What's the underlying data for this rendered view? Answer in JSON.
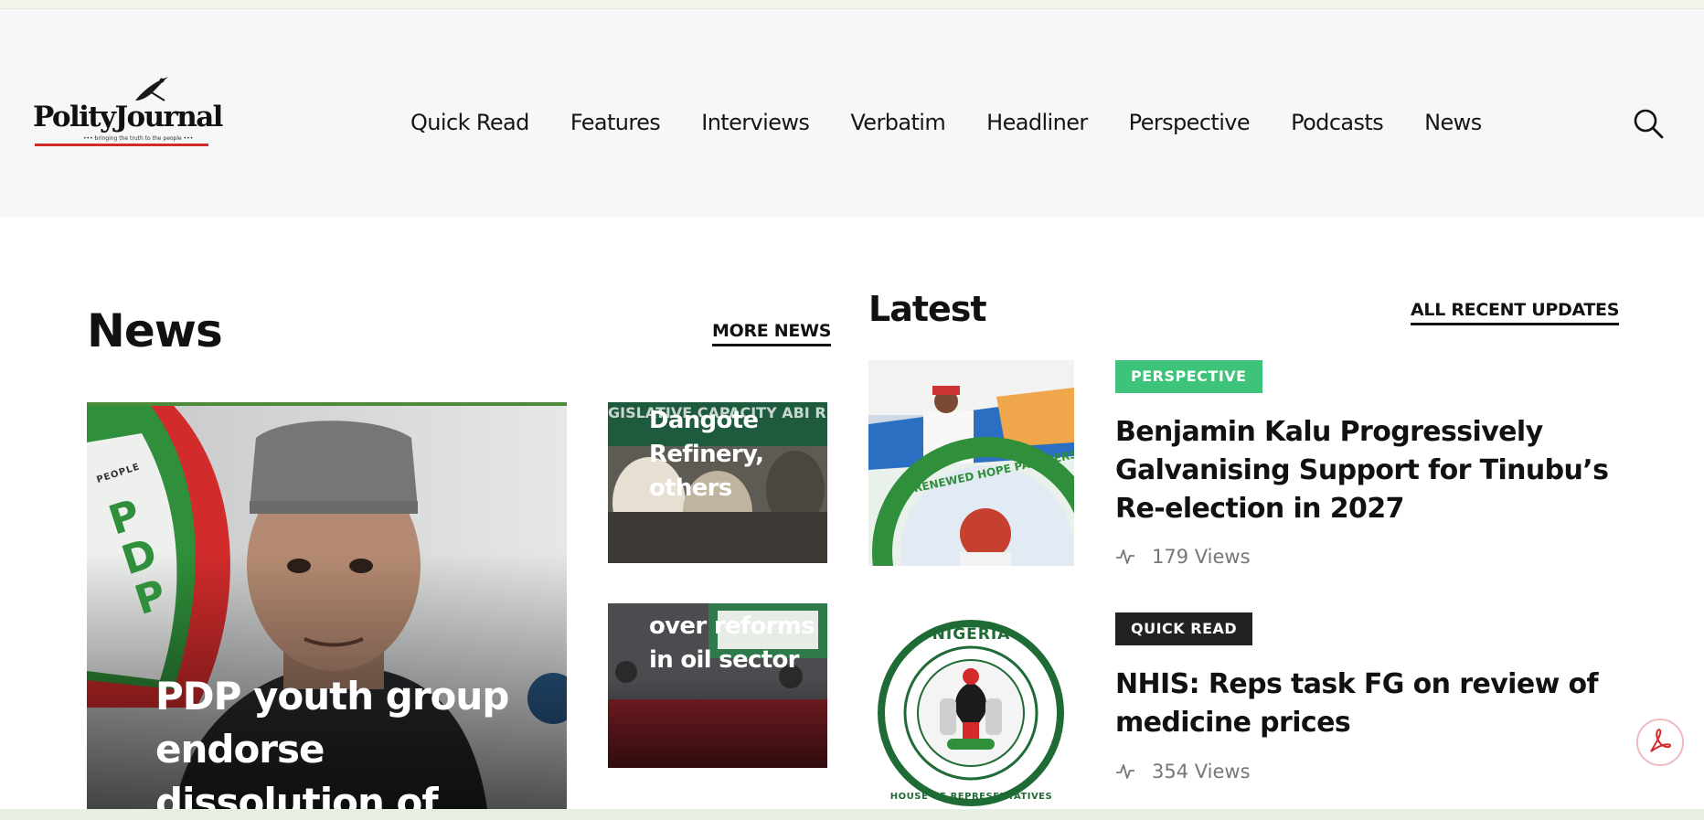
{
  "brand": {
    "logo_text": "PolityJournal",
    "tagline": "••• bringing the truth to the people •••",
    "accent_color": "#d42a2a"
  },
  "nav": {
    "items": [
      "Quick Read",
      "Features",
      "Interviews",
      "Verbatim",
      "Headliner",
      "Perspective",
      "Podcasts",
      "News"
    ],
    "search_icon": "search-icon"
  },
  "news_section": {
    "title": "News",
    "more_label": "MORE NEWS",
    "hero_title": "PDP youth group endorse dissolution of",
    "cards": [
      {
        "title": "Dangote Refinery, others"
      },
      {
        "title": "over reforms in oil sector"
      }
    ]
  },
  "latest_section": {
    "title": "Latest",
    "all_label": "ALL RECENT UPDATES",
    "items": [
      {
        "category": "PERSPECTIVE",
        "category_color": "#3ec47a",
        "title": "Benjamin Kalu Progressively Galvanising Support for Tinubu’s Re-election in 2027",
        "views": "179 Views"
      },
      {
        "category": "QUICK READ",
        "category_color": "#222222",
        "title": "NHIS: Reps task FG on review of medicine  prices",
        "views": "354 Views"
      }
    ]
  },
  "thumbnail_text": {
    "card1_banner": "GISLATIVE CAPACITY ABI  RESENTATIVE",
    "seal_top": "NIGERIA",
    "seal_bottom": "HOUSE OF REPRESENTATIVES",
    "hope_ring": "RENEWED HOPE PARTNERS",
    "pdp_letters": "PDP",
    "pdp_people": "PEOPLE"
  },
  "floating": {
    "pdf_icon": "pdf-icon"
  }
}
